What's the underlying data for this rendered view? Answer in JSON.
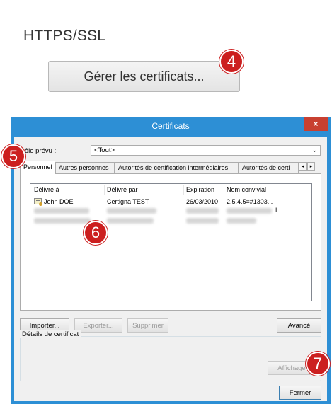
{
  "settings_panel": {
    "section_heading": "HTTPS/SSL",
    "manage_certificates_button": "Gérer les certificats..."
  },
  "markers": {
    "step4": "4",
    "step5": "5",
    "step6": "6",
    "step7": "7"
  },
  "dialog": {
    "title": "Certificats",
    "close_glyph": "×",
    "role_label": "Rôle prévu :",
    "role_value": "<Tout>",
    "tabs": [
      {
        "label": "Personnel",
        "active": true
      },
      {
        "label": "Autres personnes",
        "active": false
      },
      {
        "label": "Autorités de certification intermédiaires",
        "active": false
      },
      {
        "label": "Autorités de certi",
        "active": false
      }
    ],
    "tab_scroll_left": "◂",
    "tab_scroll_right": "▸",
    "columns": [
      "Délivré à",
      "Délivré par",
      "Expiration",
      "Nom convivial"
    ],
    "rows": [
      {
        "issued_to": "John DOE",
        "issued_by": "Certigna TEST",
        "expiration": "26/03/2010",
        "friendly_name": "2.5.4.5=#1303..."
      }
    ],
    "blurred_row_trailing_char": "L",
    "buttons": {
      "import": "Importer...",
      "export": "Exporter...",
      "remove": "Supprimer",
      "advanced": "Avancé",
      "view": "Affichage",
      "close": "Fermer"
    },
    "details_group_label": "Détails de certificat"
  },
  "colors": {
    "dialog_frame": "#2d8fd5",
    "close_button": "#c84031",
    "marker": "#cc1f1f"
  }
}
